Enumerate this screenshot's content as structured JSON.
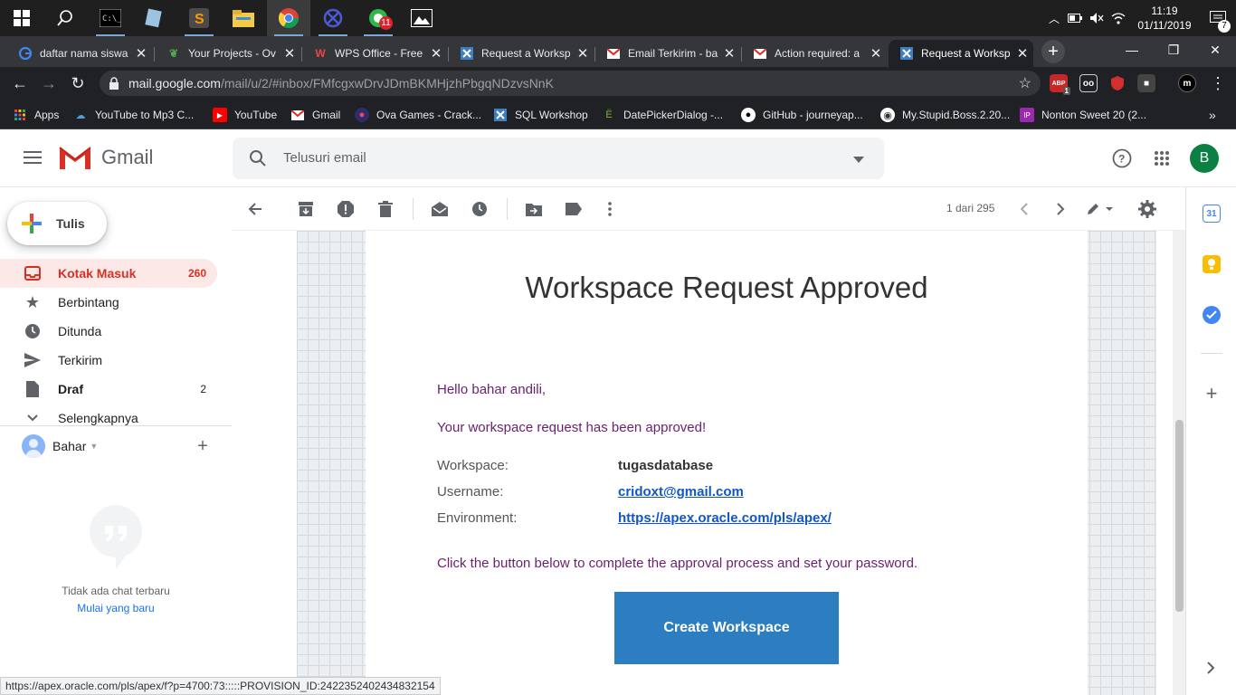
{
  "taskbar": {
    "apps": [
      {
        "name": "start-icon"
      },
      {
        "name": "search-icon"
      },
      {
        "name": "cmd-icon"
      },
      {
        "name": "notebook-icon"
      },
      {
        "name": "sublime-icon"
      },
      {
        "name": "file-explorer-icon"
      },
      {
        "name": "chrome-icon"
      },
      {
        "name": "network-app-icon"
      },
      {
        "name": "whatsapp-icon",
        "badge": "11"
      },
      {
        "name": "photos-icon"
      }
    ],
    "time": "11:19",
    "date": "01/11/2019",
    "notification_count": "7"
  },
  "browser": {
    "tabs": [
      {
        "title": "daftar nama siswa",
        "favicon": "google-icon"
      },
      {
        "title": "Your Projects - Ov",
        "favicon": "overleaf-icon"
      },
      {
        "title": "WPS Office - Free",
        "favicon": "wps-icon"
      },
      {
        "title": "Request a Worksp",
        "favicon": "apex-icon"
      },
      {
        "title": "Email Terkirim - ba",
        "favicon": "gmail-icon"
      },
      {
        "title": "Action required: a",
        "favicon": "gmail-icon"
      },
      {
        "title": "Request a Worksp",
        "favicon": "apex-icon"
      }
    ],
    "url_host": "mail.google.com",
    "url_path": "/mail/u/2/#inbox/FMfcgxwDrvJDmBKMHjzhPbgqNDzvsNnK",
    "bookmarks": [
      {
        "label": "Apps"
      },
      {
        "label": "YouTube to Mp3 C..."
      },
      {
        "label": "YouTube"
      },
      {
        "label": "Gmail"
      },
      {
        "label": "Ova Games - Crack..."
      },
      {
        "label": "SQL Workshop"
      },
      {
        "label": "DatePickerDialog -..."
      },
      {
        "label": "GitHub - journeyap..."
      },
      {
        "label": "My.Stupid.Boss.2.20..."
      },
      {
        "label": "Nonton Sweet 20 (2..."
      }
    ],
    "status_url": "https://apex.oracle.com/pls/apex/f?p=4700:73:::::PROVISION_ID:2422352402434832154",
    "ext_badge": "1",
    "ext_abp_label": "ABP"
  },
  "gmail": {
    "logo_text": "Gmail",
    "search_placeholder": "Telusuri email",
    "avatar_letter": "B",
    "compose_label": "Tulis",
    "nav": [
      {
        "label": "Kotak Masuk",
        "count": "260"
      },
      {
        "label": "Berbintang",
        "count": ""
      },
      {
        "label": "Ditunda",
        "count": ""
      },
      {
        "label": "Terkirim",
        "count": ""
      },
      {
        "label": "Draf",
        "count": "2"
      },
      {
        "label": "Selengkapnya",
        "count": ""
      }
    ],
    "hangouts_user": "Bahar",
    "chat_empty": "Tidak ada chat terbaru",
    "chat_start": "Mulai yang baru",
    "pager": "1 dari 295",
    "calendar_day": "31"
  },
  "email": {
    "title": "Workspace Request Approved",
    "greeting": "Hello bahar andili,",
    "approved_line": "Your workspace request has been approved!",
    "details": [
      {
        "key": "Workspace:",
        "value": "tugasdatabase"
      },
      {
        "key": "Username:",
        "value": "cridoxt@gmail.com"
      },
      {
        "key": "Environment:",
        "value": "https://apex.oracle.com/pls/apex/"
      }
    ],
    "instruction": "Click the button below to complete the approval process and set your password.",
    "cta_label": "Create Workspace"
  },
  "colors": {
    "taskbar_bg": "#1f1f1f",
    "chrome_dark": "#202124",
    "gmail_red": "#d93025",
    "email_purple": "#6b1f6f",
    "link_blue": "#1155cc",
    "cta_blue": "#2d7ec0"
  }
}
